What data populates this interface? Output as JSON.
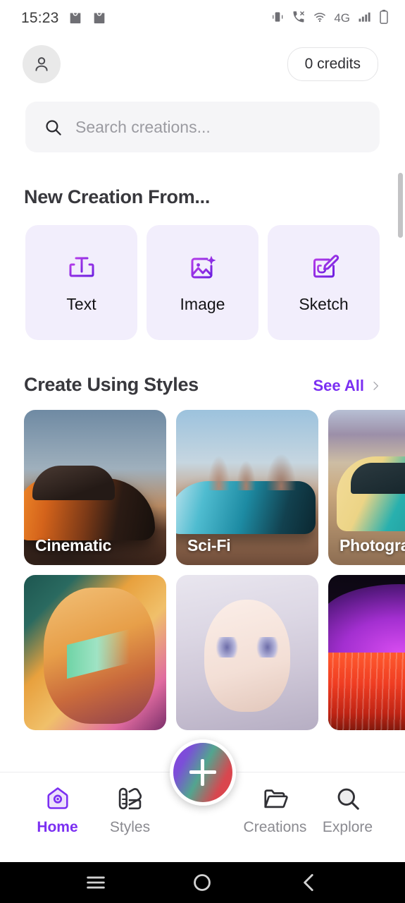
{
  "status_bar": {
    "time": "15:23",
    "left_icons": [
      "shopping-bag-icon",
      "shopping-bag-icon"
    ],
    "right_icons": [
      "vibrate-icon",
      "call-mute-icon",
      "wifi-icon",
      "network-4g-icon",
      "signal-bars-icon",
      "battery-icon"
    ],
    "network_label": "4G"
  },
  "header": {
    "avatar_icon": "person-icon",
    "credits_label": "0 credits"
  },
  "search": {
    "icon": "search-icon",
    "placeholder": "Search creations...",
    "value": ""
  },
  "new_creation": {
    "title": "New Creation From...",
    "options": [
      {
        "label": "Text",
        "icon": "text-box-icon"
      },
      {
        "label": "Image",
        "icon": "image-sparkle-icon"
      },
      {
        "label": "Sketch",
        "icon": "sketch-pencil-icon"
      }
    ]
  },
  "styles_section": {
    "title": "Create Using Styles",
    "see_all_label": "See All",
    "see_all_icon": "chevron-right-icon",
    "cards": [
      {
        "label": "Cinematic",
        "art": "art-cinematic"
      },
      {
        "label": "Sci-Fi",
        "art": "art-scifi"
      },
      {
        "label": "Photographic",
        "art": "art-photographic"
      },
      {
        "label": "",
        "art": "art-comic"
      },
      {
        "label": "",
        "art": "art-anime"
      },
      {
        "label": "",
        "art": "art-neon"
      }
    ]
  },
  "bottom_nav": {
    "items": [
      {
        "label": "Home",
        "icon": "home-icon",
        "active": true
      },
      {
        "label": "Styles",
        "icon": "palette-icon",
        "active": false
      },
      {
        "label": "Creations",
        "icon": "folder-icon",
        "active": false
      },
      {
        "label": "Explore",
        "icon": "search-icon",
        "active": false
      }
    ],
    "fab": {
      "icon": "plus-icon",
      "label": ""
    }
  },
  "system_nav": {
    "recents_icon": "menu-icon",
    "home_icon": "circle-icon",
    "back_icon": "chevron-left-icon"
  },
  "colors": {
    "accent": "#7b2ff2",
    "card_bg": "#f2eefc",
    "search_bg": "#f5f5f7",
    "text_primary": "#38383d",
    "text_muted": "#8a8a90"
  }
}
